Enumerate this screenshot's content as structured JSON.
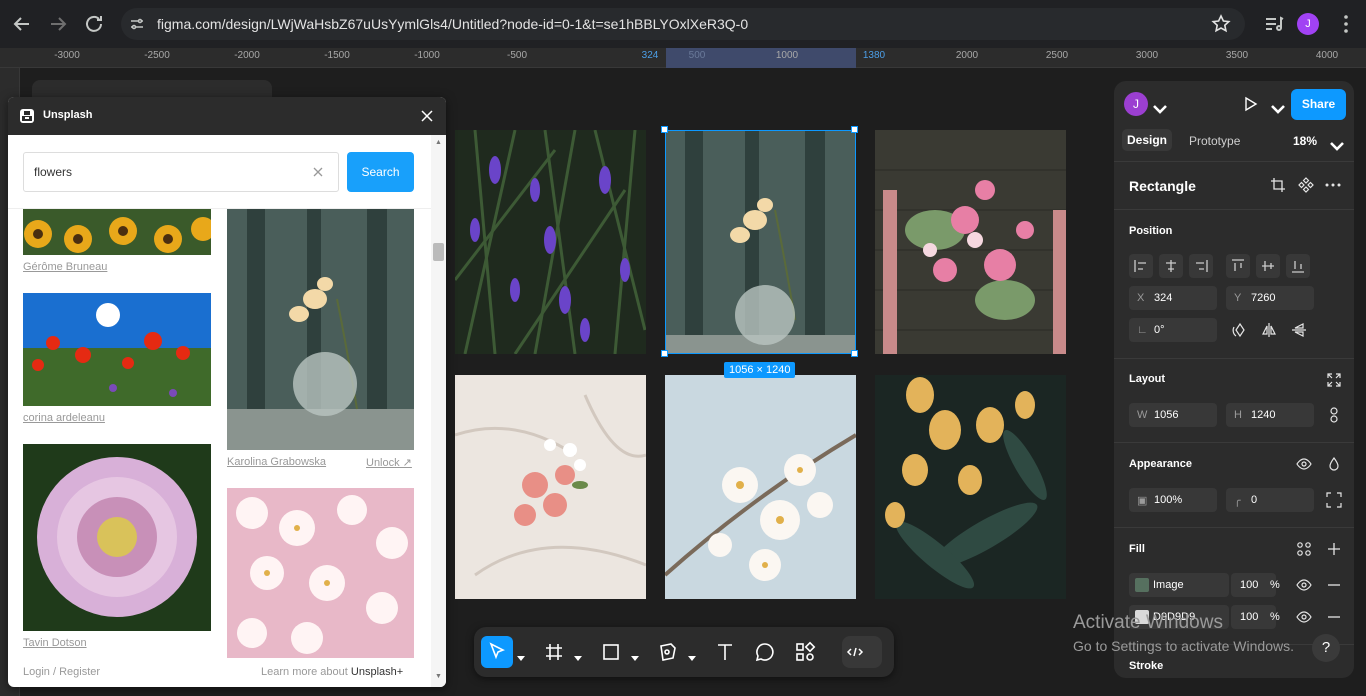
{
  "browser": {
    "url": "figma.com/design/LWjWaHsbZ67uUsYymlGls4/Untitled?node-id=0-1&t=se1hBBLYOxlXeR3Q-0",
    "profile_initial": "J"
  },
  "ruler": {
    "labels": [
      "-3000",
      "-2500",
      "-2000",
      "-1500",
      "-1000",
      "-500",
      "324",
      "500",
      "1000",
      "1380",
      "2000",
      "2500",
      "3000",
      "3500",
      "4000"
    ],
    "selected_start": "324",
    "selected_end": "1380"
  },
  "canvas": {
    "selection_size": "1056 × 1240"
  },
  "unsplash": {
    "title": "Unsplash",
    "search_value": "flowers",
    "search_button": "Search",
    "credits": [
      "Gérôme Bruneau",
      "corina ardeleanu",
      "Karolina Grabowska",
      "Unlock ↗",
      "Tavin Dotson"
    ],
    "footer_left": "Login / Register",
    "footer_right_prefix": "Learn more about ",
    "footer_right_link": "Unsplash+"
  },
  "toolbar": {
    "tools": [
      "move-tool",
      "frame-tool",
      "shape-tool",
      "pen-tool",
      "text-tool",
      "comment-tool",
      "actions-tool",
      "dev-mode-toggle"
    ]
  },
  "panel": {
    "avatar_initial": "J",
    "share_label": "Share",
    "tab_design": "Design",
    "tab_prototype": "Prototype",
    "zoom": "18%",
    "layer_type": "Rectangle",
    "position_label": "Position",
    "x_key": "X",
    "x_value": "324",
    "y_key": "Y",
    "y_value": "7260",
    "rotation_value": "0°",
    "layout_label": "Layout",
    "w_key": "W",
    "w_value": "1056",
    "h_key": "H",
    "h_value": "1240",
    "appearance_label": "Appearance",
    "opacity_value": "100%",
    "radius_value": "0",
    "fill_label": "Fill",
    "fills": [
      {
        "name": "Image",
        "opacity": "100",
        "unit": "%"
      },
      {
        "name": "D9D9D9",
        "opacity": "100",
        "unit": "%"
      }
    ],
    "stroke_label": "Stroke"
  },
  "windows_watermark": {
    "line1": "Activate Windows",
    "line2": "Go to Settings to activate Windows."
  },
  "colors": {
    "accent": "#0d99ff",
    "panel_bg": "#2c2c2c",
    "canvas_bg": "#1e1e1e"
  }
}
